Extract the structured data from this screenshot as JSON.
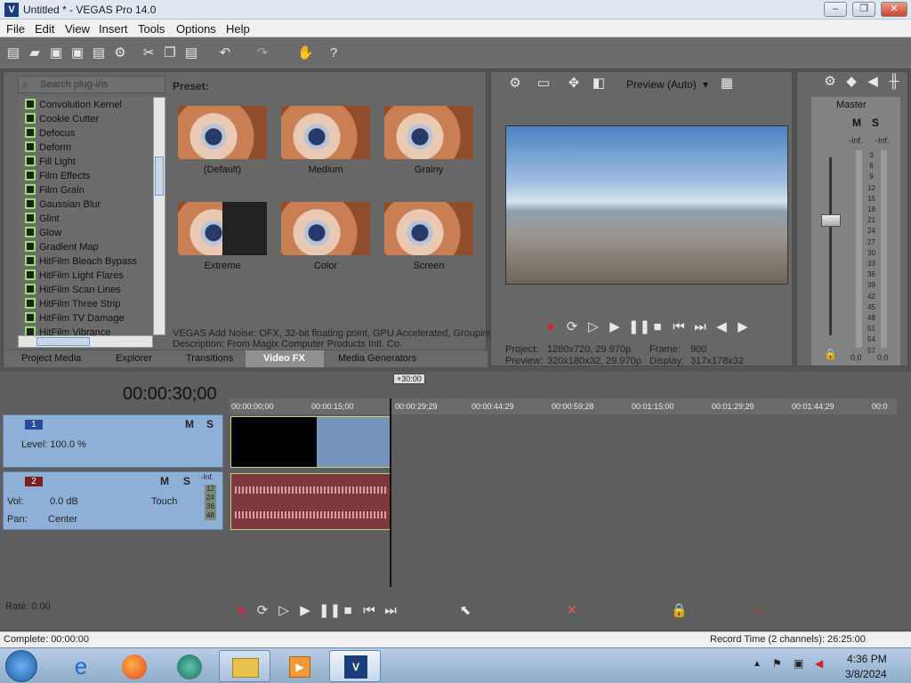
{
  "window": {
    "title": "Untitled * - VEGAS Pro 14.0"
  },
  "menu": [
    "File",
    "Edit",
    "View",
    "Insert",
    "Tools",
    "Options",
    "Help"
  ],
  "explorer": {
    "search_placeholder": "Search plug-ins",
    "preset_label": "Preset:",
    "plugins": [
      "Convolution Kernel",
      "Cookie Cutter",
      "Defocus",
      "Deform",
      "Fill Light",
      "Film Effects",
      "Film Grain",
      "Gaussian Blur",
      "Glint",
      "Glow",
      "Gradient Map",
      "HitFilm Bleach Bypass",
      "HitFilm Light Flares",
      "HitFilm Scan Lines",
      "HitFilm Three Strip",
      "HitFilm TV Damage",
      "HitFilm Vibrance"
    ],
    "presets": [
      "(Default)",
      "Medium",
      "Grainy",
      "Extreme",
      "Color",
      "Screen"
    ],
    "info_line1": "VEGAS Add Noise: OFX, 32-bit floating point, GPU Accelerated, Grouping",
    "info_line2": "Description: From Magix Computer Products Intl. Co.",
    "tabs": [
      "Project Media",
      "Explorer",
      "Transitions",
      "Video FX",
      "Media Generators"
    ],
    "active_tab": "Video FX"
  },
  "preview": {
    "mode": "Preview (Auto)",
    "project_label": "Project:",
    "project_value": "1280x720, 29.970p",
    "preview_label": "Preview:",
    "preview_value": "320x180x32, 29.970p",
    "frame_label": "Frame:",
    "frame_value": "900",
    "display_label": "Display:",
    "display_value": "317x178x32"
  },
  "mixer": {
    "label": "Master",
    "inf_left": "-Inf.",
    "inf_right": "-Inf.",
    "scale": [
      "3",
      "6",
      "9",
      "12",
      "15",
      "18",
      "21",
      "24",
      "27",
      "30",
      "33",
      "36",
      "39",
      "42",
      "45",
      "48",
      "51",
      "54",
      "57"
    ],
    "bottom_left": "0.0",
    "bottom_right": "0.0"
  },
  "timeline": {
    "time": "00:00:30;00",
    "marker": "+30:00",
    "ruler": [
      "00:00:00;00",
      "00:00:15;00",
      "00:00:29;29",
      "00:00:44;29",
      "00:00:59;28",
      "00:01:15;00",
      "00:01:29;29",
      "00:01:44;29",
      "00:0"
    ],
    "video_track": {
      "num": "1",
      "level": "Level: 100.0 %",
      "m": "M",
      "s": "S"
    },
    "audio_track": {
      "num": "2",
      "vol_label": "Vol:",
      "vol_value": "0.0 dB",
      "pan_label": "Pan:",
      "pan_value": "Center",
      "automation": "Touch",
      "m": "M",
      "s": "S",
      "inf": "-Inf.",
      "meter": [
        "12",
        "24",
        "36",
        "48"
      ]
    },
    "rate": "Rate: 0.00"
  },
  "status": {
    "left": "Complete: 00:00:00",
    "right": "Record Time (2 channels): 26:25:00"
  },
  "taskbar": {
    "time": "4:36 PM",
    "date": "3/8/2024"
  }
}
